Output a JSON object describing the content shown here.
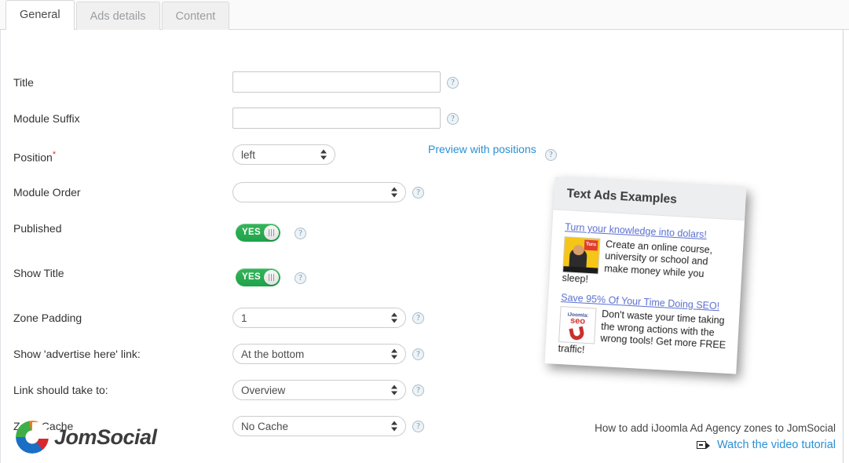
{
  "tabs": [
    {
      "label": "General",
      "active": true
    },
    {
      "label": "Ads details",
      "active": false
    },
    {
      "label": "Content",
      "active": false
    }
  ],
  "form": {
    "rows": [
      {
        "label": "Title",
        "type": "text",
        "value": "",
        "help": "?"
      },
      {
        "label": "Module Suffix",
        "type": "text",
        "value": "",
        "help": "?"
      },
      {
        "label": "Position",
        "required": true,
        "type": "select",
        "value": "left",
        "help": "?"
      },
      {
        "label": "Module Order",
        "type": "select",
        "value": "",
        "help": "?"
      },
      {
        "label": "Published",
        "type": "toggle",
        "value": "YES",
        "help": "?"
      },
      {
        "label": "Show Title",
        "type": "toggle",
        "value": "YES",
        "help": "?"
      },
      {
        "label": "Zone Padding",
        "type": "select",
        "value": "1",
        "help": "?"
      },
      {
        "label": "Show 'advertise here' link:",
        "type": "select",
        "value": "At the bottom",
        "help": "?"
      },
      {
        "label": "Link should take to:",
        "type": "select",
        "value": "Overview",
        "help": "?"
      },
      {
        "label": "Zone Cache",
        "type": "select",
        "value": "No Cache",
        "help": "?"
      }
    ],
    "required_marker": "*",
    "preview_link": "Preview with positions",
    "preview_help": "?"
  },
  "promo": {
    "title": "Text Ads Examples",
    "ads": [
      {
        "headline": "Turn your knowledge into dolars!",
        "body": "Create an online course, university or school and make money while you sleep!",
        "thumb_badge": "Turu"
      },
      {
        "headline": "Save 95% Of Your Time Doing SEO!",
        "body": "Don't waste your time taking the wrong actions with the wrong tools! Get more FREE traffic!",
        "thumb_brand": "iJoomla:",
        "thumb_word": "seo"
      }
    ]
  },
  "footer": {
    "logo_text": "JomSocial",
    "caption": "How to add iJoomla Ad Agency zones to JomSocial",
    "watch_label": "Watch the video tutorial"
  },
  "colors": {
    "link": "#2a90d4",
    "toggle_on": "#2aa84f",
    "required": "#e0342b",
    "ad_headline": "#5a6fd0"
  }
}
